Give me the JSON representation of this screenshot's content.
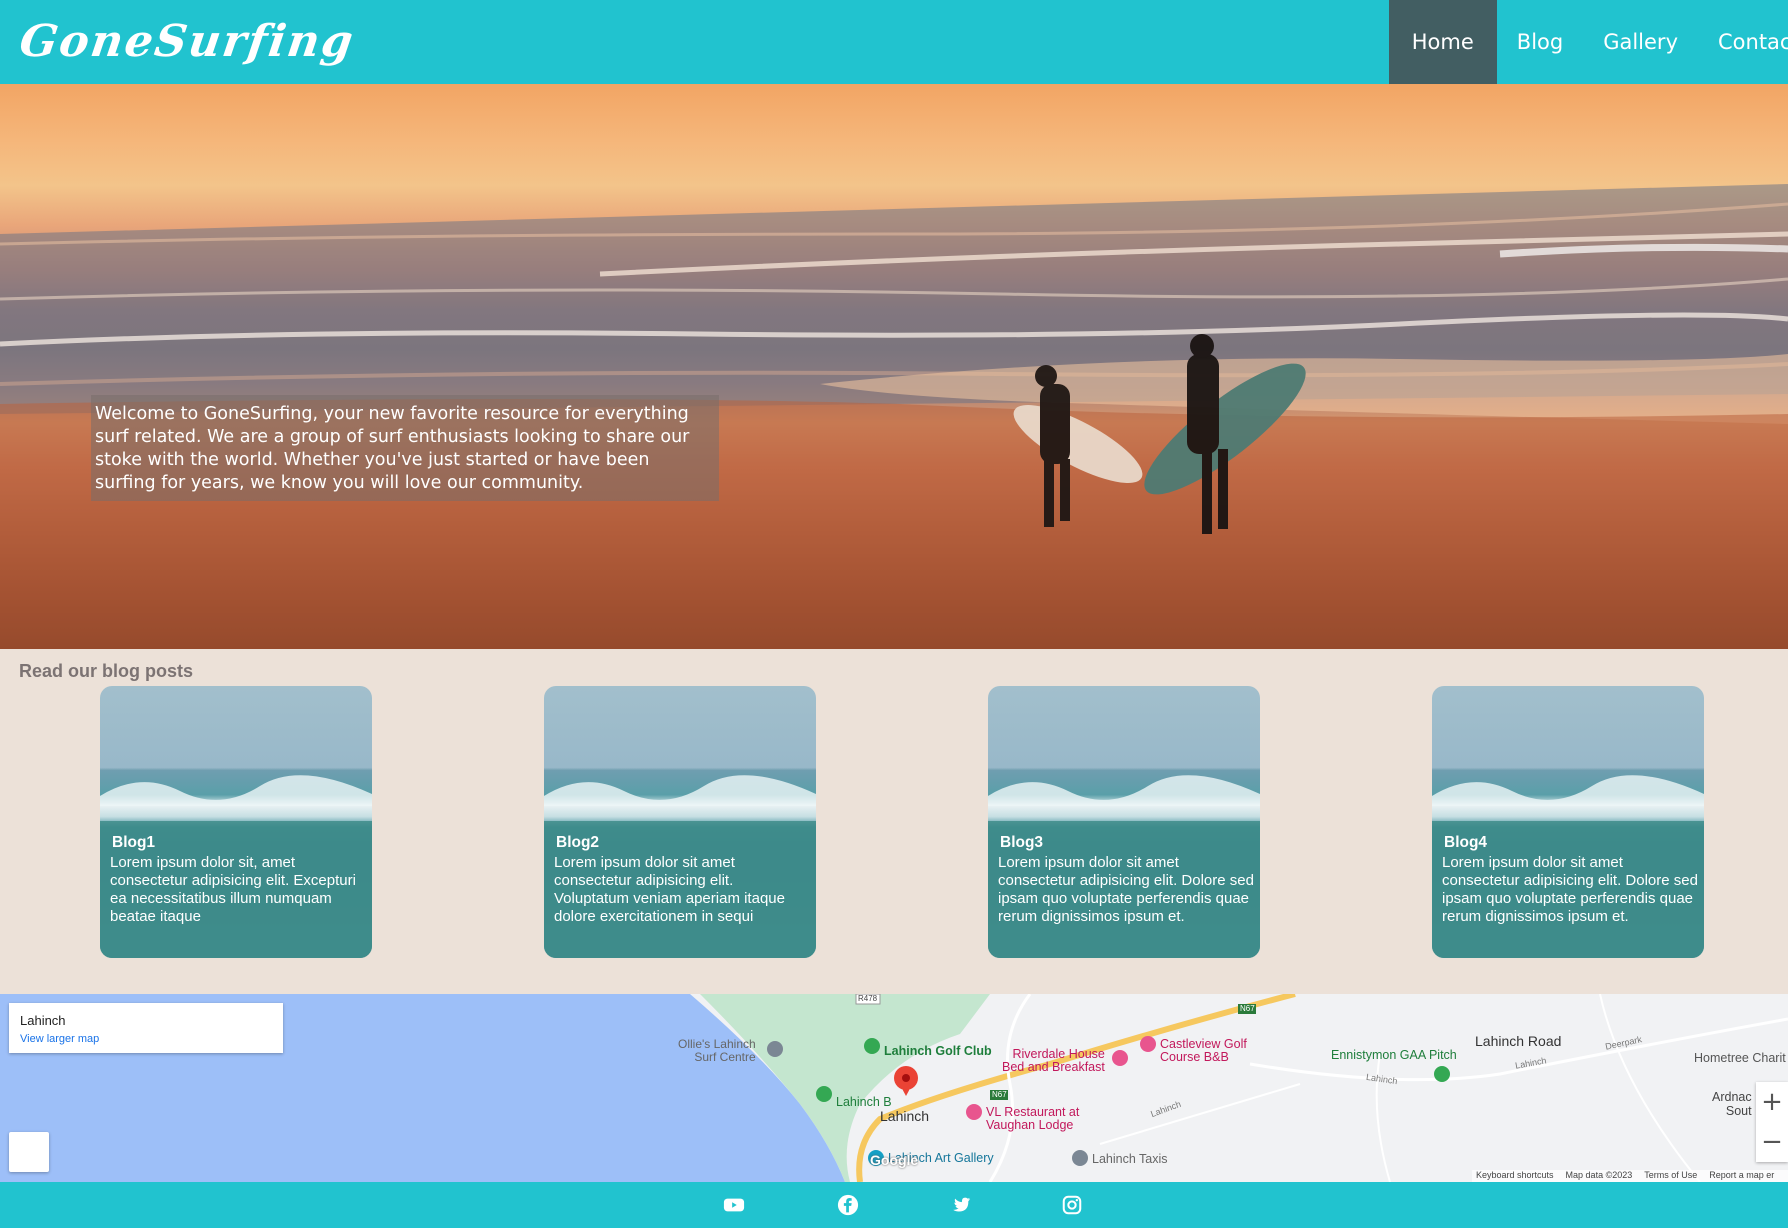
{
  "header": {
    "logo": "GoneSurfing",
    "nav": [
      {
        "label": "Home",
        "active": true
      },
      {
        "label": "Blog",
        "active": false
      },
      {
        "label": "Gallery",
        "active": false
      },
      {
        "label": "Contac",
        "active": false
      }
    ]
  },
  "hero": {
    "intro": "Welcome to GoneSurfing, your new favorite resource for everything surf related. We are a group of surf enthusiasts looking to share our stoke with the world. Whether you've just started or have been surfing for years, we know you will love our community."
  },
  "blog": {
    "heading": "Read our blog posts",
    "posts": [
      {
        "title": "Blog1",
        "text": "Lorem ipsum dolor sit, amet consectetur adipisicing elit. Excepturi ea necessitatibus illum numquam beatae itaque"
      },
      {
        "title": "Blog2",
        "text": "Lorem ipsum dolor sit amet consectetur adipisicing elit. Voluptatum veniam aperiam itaque dolore exercitationem in sequi"
      },
      {
        "title": "Blog3",
        "text": "Lorem ipsum dolor sit amet consectetur adipisicing elit. Dolore sed ipsam quo voluptate perferendis quae rerum dignissimos ipsum et."
      },
      {
        "title": "Blog4",
        "text": "Lorem ipsum dolor sit amet consectetur adipisicing elit. Dolore sed ipsam quo voluptate perferendis quae rerum dignissimos ipsum et."
      }
    ]
  },
  "map": {
    "place_title": "Lahinch",
    "larger_map_link": "View larger map",
    "labels": {
      "ollies": "Ollie's Lahinch\nSurf Centre",
      "golf_club": "Lahinch Golf Club",
      "riverdale": "Riverdale House\nBed and Breakfast",
      "castleview": "Castleview Golf\nCourse B&B",
      "ennistymon": "Ennistymon GAA Pitch",
      "lahinch_road": "Lahinch Road",
      "hometree": "Hometree Charit",
      "ardnac": "Ardnac\nSout",
      "lahinch_beach": "Lahinch B",
      "lahinch_town": "Lahinch",
      "vl_restaurant": "VL Restaurant at\nVaughan Lodge",
      "art_gallery": "Lahinch Art Gallery",
      "taxis": "Lahinch Taxis",
      "r478": "R478",
      "n67a": "N67",
      "n67b": "N67",
      "deerpark": "Deerpark",
      "lahinch_small1": "Lahinch",
      "lahinch_small2": "Lahinch",
      "lahinch_small3": "Lahinch"
    },
    "google": "Google",
    "zoom_in": "+",
    "zoom_out": "−",
    "footer": [
      "Keyboard shortcuts",
      "Map data ©2023",
      "Terms of Use",
      "Report a map er"
    ]
  },
  "footer": {
    "social": [
      "youtube-icon",
      "facebook-icon",
      "twitter-icon",
      "instagram-icon"
    ]
  },
  "colors": {
    "brand": "#21c3cf",
    "nav_active": "#425e62",
    "section_bg": "#ece1d8",
    "card_overlay": "#408c8a",
    "water": "#9dbff8"
  }
}
